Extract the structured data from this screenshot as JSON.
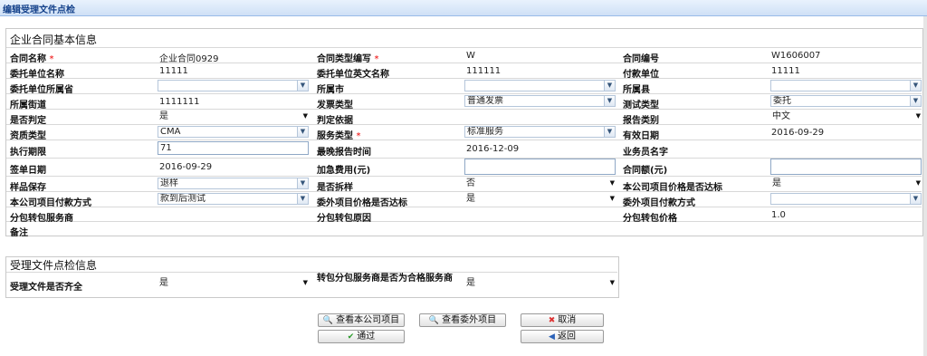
{
  "window": {
    "title": "编辑受理文件点检"
  },
  "basic": {
    "title": "企业合同基本信息",
    "contract_name": {
      "label": "合同名称",
      "value": "企业合同0929"
    },
    "contract_type_no": {
      "label": "合同类型编写",
      "value": "W"
    },
    "contract_no": {
      "label": "合同编号",
      "value": "W1606007"
    },
    "client_name": {
      "label": "委托单位名称",
      "value": "11111"
    },
    "client_en_name": {
      "label": "委托单位英文名称",
      "value": "111111"
    },
    "payer": {
      "label": "付款单位",
      "value": "11111"
    },
    "client_province": {
      "label": "委托单位所属省",
      "value": ""
    },
    "city": {
      "label": "所属市",
      "value": ""
    },
    "county": {
      "label": "所属县",
      "value": ""
    },
    "street": {
      "label": "所属街道",
      "value": "1111111"
    },
    "invoice_type": {
      "label": "发票类型",
      "value": "普通发票"
    },
    "test_type": {
      "label": "测试类型",
      "value": "委托"
    },
    "is_judged": {
      "label": "是否判定",
      "value": "是"
    },
    "judge_basis": {
      "label": "判定依据",
      "value": ""
    },
    "report_type": {
      "label": "报告类别",
      "value": "中文"
    },
    "qualification": {
      "label": "资质类型",
      "value": "CMA"
    },
    "service_type": {
      "label": "服务类型",
      "value": "标准服务"
    },
    "valid_date": {
      "label": "有效日期",
      "value": "2016-09-29"
    },
    "exec_period": {
      "label": "执行期限",
      "value": "71"
    },
    "latest_report": {
      "label": "最晚报告时间",
      "value": "2016-12-09"
    },
    "salesman": {
      "label": "业务员名字",
      "value": ""
    },
    "sign_date": {
      "label": "签单日期",
      "value": "2016-09-29"
    },
    "urgent_fee": {
      "label": "加急费用(元)",
      "value": ""
    },
    "contract_amount": {
      "label": "合同额(元)",
      "value": ""
    },
    "sample_keep": {
      "label": "样品保存",
      "value": "退样"
    },
    "is_disassemble": {
      "label": "是否拆样",
      "value": "否"
    },
    "price_ok": {
      "label": "本公司项目价格是否达标",
      "value": "是"
    },
    "pay_method": {
      "label": "本公司项目付款方式",
      "value": "款到后测试"
    },
    "ext_price_ok": {
      "label": "委外项目价格是否达标",
      "value": "是"
    },
    "ext_pay_method": {
      "label": "委外项目付款方式",
      "value": ""
    },
    "sub_provider": {
      "label": "分包转包服务商",
      "value": ""
    },
    "sub_reason": {
      "label": "分包转包原因",
      "value": ""
    },
    "sub_price": {
      "label": "分包转包价格",
      "value": "1.0"
    },
    "remark": {
      "label": "备注",
      "value": ""
    }
  },
  "inspect": {
    "title": "受理文件点检信息",
    "docs_complete": {
      "label": "受理文件是否齐全",
      "value": "是"
    },
    "qualified": {
      "label": "转包分包服务商是否为合格服务商",
      "value": "是"
    }
  },
  "buttons": {
    "view_own": "查看本公司项目",
    "view_ext": "查看委外项目",
    "cancel": "取消",
    "pass": "通过",
    "back": "返回"
  },
  "required_mark": "*",
  "colors": {
    "accent": "#15428b",
    "border": "#8fa8c6"
  }
}
